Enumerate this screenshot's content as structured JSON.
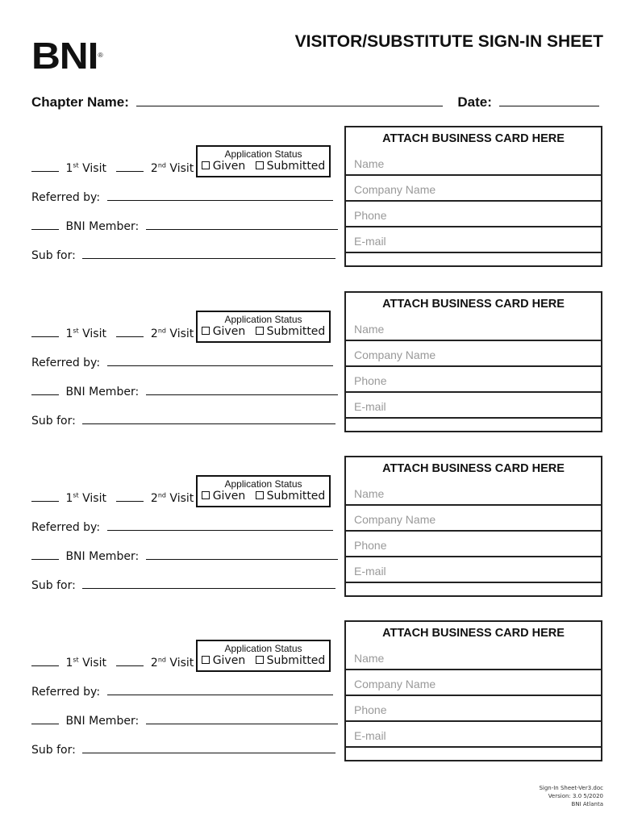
{
  "header": {
    "logo_text": "BNI",
    "logo_registered": "®",
    "title": "VISITOR/SUBSTITUTE SIGN-IN SHEET"
  },
  "form_header": {
    "chapter_label": "Chapter Name:",
    "date_label": "Date:"
  },
  "entry": {
    "first_visit_num": "1",
    "first_visit_sup": "st",
    "first_visit_label": " Visit",
    "second_visit_num": "2",
    "second_visit_sup": "nd",
    "second_visit_label": " Visit",
    "status_title": "Application Status",
    "status_given": "Given",
    "status_submitted": "Submitted",
    "referred_label": "Referred by:",
    "member_label": "BNI Member:",
    "sub_label": "Sub for:",
    "card_title": "ATTACH BUSINESS CARD HERE",
    "card_fields": [
      "Name",
      "Company Name",
      "Phone",
      "E-mail"
    ]
  },
  "sections_count": 4,
  "footer": {
    "filename": "Sign-In Sheet-Ver3.doc",
    "version": "Version: 3.0 5/2020",
    "org": "BNI Atlanta"
  }
}
